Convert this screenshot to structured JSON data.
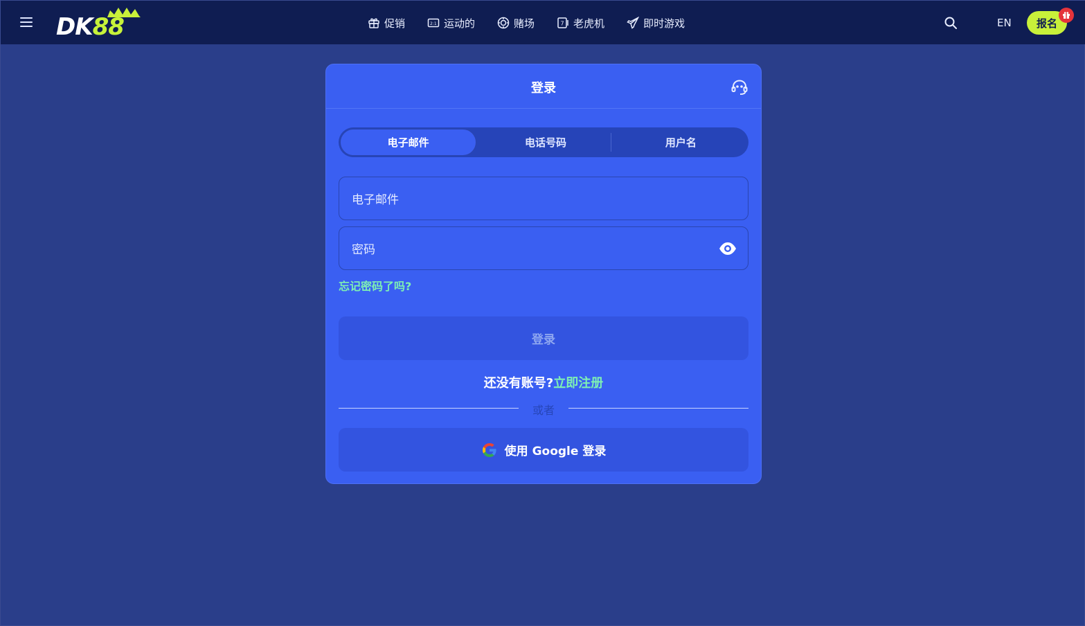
{
  "header": {
    "logo_text_dk": "DK",
    "logo_text_num": "88",
    "nav": [
      {
        "label": "促销",
        "icon": "gift-icon"
      },
      {
        "label": "运动的",
        "icon": "scoreboard-icon"
      },
      {
        "label": "赌场",
        "icon": "chip-icon"
      },
      {
        "label": "老虎机",
        "icon": "slot-icon"
      },
      {
        "label": "即时游戏",
        "icon": "rocket-icon"
      }
    ],
    "language": "EN",
    "signup_label": "报名"
  },
  "login": {
    "title": "登录",
    "tabs": [
      "电子邮件",
      "电话号码",
      "用户名"
    ],
    "active_tab": "电子邮件",
    "email_placeholder": "电子邮件",
    "password_placeholder": "密码",
    "forgot_password": "忘记密码了吗?",
    "login_button": "登录",
    "no_account": "还没有账号?",
    "register_link": "立即注册",
    "or_text": "或者",
    "google_button": "使用 Google 登录"
  },
  "colors": {
    "background": "#2a3e8a",
    "topbar": "#0f1d52",
    "modal": "#3a5ff2",
    "accent_green": "#c8f03a",
    "link_green": "#7ef0b4"
  }
}
